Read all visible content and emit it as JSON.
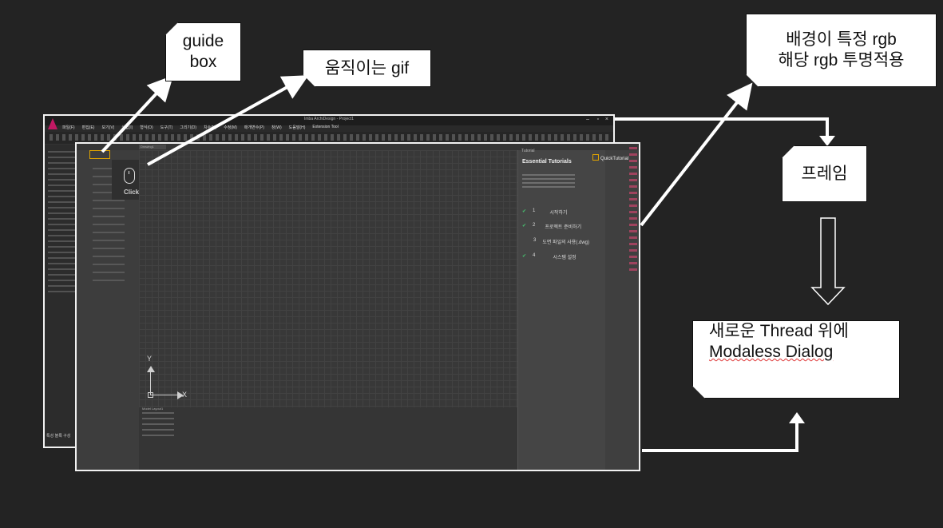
{
  "callouts": {
    "guide_box": [
      "guide",
      "box"
    ],
    "moving_gif": "움직이는 gif",
    "background_rgb": [
      "배경이 특정 rgb",
      "해당 rgb 투명적용"
    ],
    "frame": "프레임",
    "thread_dialog": [
      "새로운 Thread 위에",
      "Modaless Dialog"
    ]
  },
  "app": {
    "title": "Imba ArchiDesign - Project1",
    "menu": [
      "파일(F)",
      "편집(E)",
      "보기(V)",
      "삽입(I)",
      "형식(O)",
      "도구(T)",
      "그리기(D)",
      "치수(N)",
      "수정(M)",
      "매개변수(P)",
      "창(W)",
      "도움말(H)",
      "Extension Tool"
    ],
    "left_tabs": "특성  블록 구성"
  },
  "frame": {
    "doc_tab": "Drawing1",
    "gif_click": "Click",
    "axis_x": "X",
    "axis_y": "Y",
    "tutorial_panel_label": "Tutorial",
    "quick_tutorial": "QuickTutorial",
    "tutorial_title": "Essential Tutorials",
    "tutorial_items": [
      {
        "num": "1",
        "label": "시작하기",
        "done": true
      },
      {
        "num": "2",
        "label": "프로젝트 준비하기",
        "done": true
      },
      {
        "num": "3",
        "label": "도면 파일의 사용(.dwg)",
        "done": false
      },
      {
        "num": "4",
        "label": "시스템 설정",
        "done": true
      }
    ],
    "layout_tabs": "Model  Layout1"
  },
  "colors": {
    "background": "#232323",
    "accent_brand": "#c21863",
    "guide_highlight": "#e0a400",
    "check_green": "#47b26a"
  }
}
